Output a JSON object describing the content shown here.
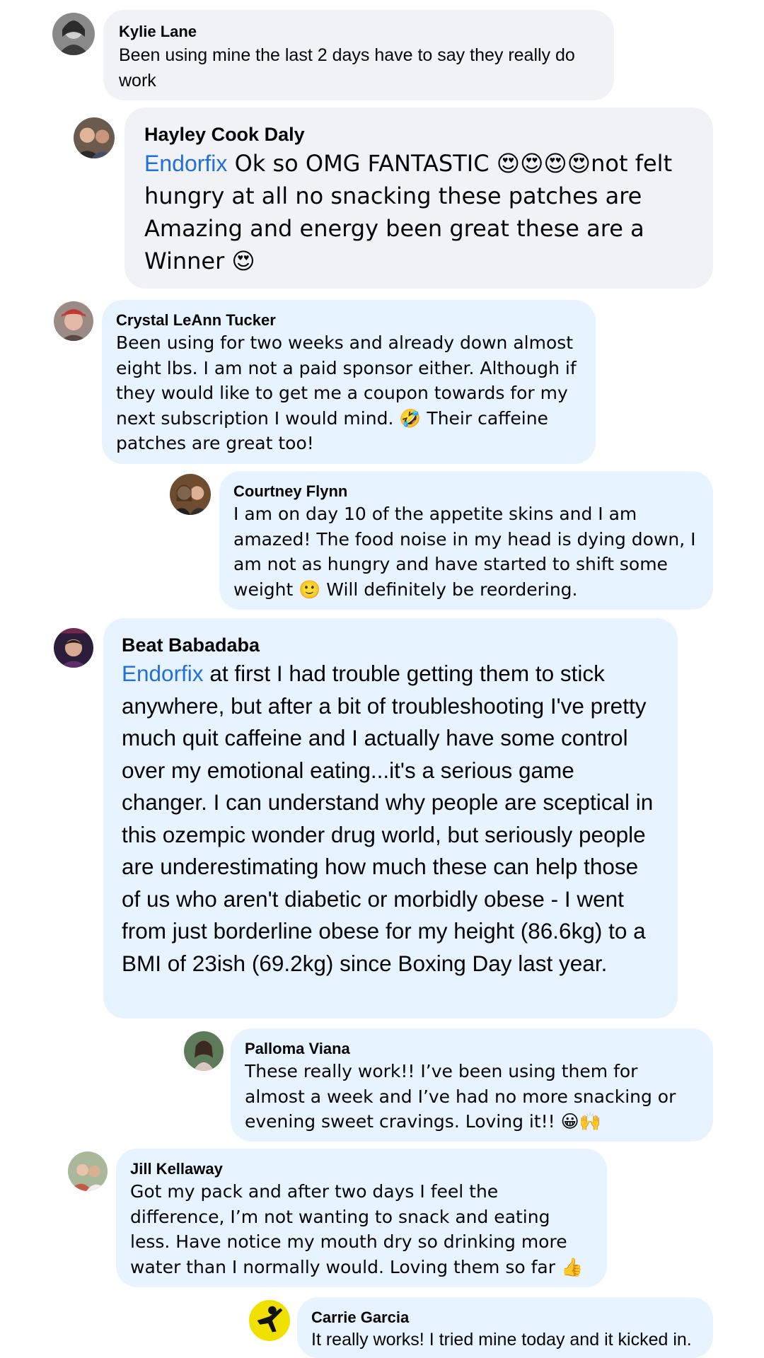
{
  "comments": [
    {
      "name": "Kylie Lane",
      "text": "Been using mine the last 2 days have to say they really do work"
    },
    {
      "name": "Hayley Cook Daly",
      "mention": "Endorfix",
      "text": " Ok so OMG FANTASTIC 😍😍😍😍not felt hungry at all no snacking these patches are Amazing and energy been great these are a Winner 😍"
    },
    {
      "name": "Crystal LeAnn Tucker",
      "text": "Been using for two weeks and already down almost eight lbs. I am not a paid sponsor either. Although if they would like to get me a coupon towards for my next subscription I would mind. 🤣 Their caffeine patches are great too!"
    },
    {
      "name": "Courtney Flynn",
      "text": "I am on day 10 of the appetite skins and I am amazed! The food noise in my head is dying down, I am not as hungry and have started to shift some weight 🙂 Will definitely be reordering."
    },
    {
      "name": "Beat Babadaba",
      "mention": "Endorfix",
      "text": " at first I had trouble getting them to stick anywhere, but after a bit of troubleshooting I've pretty much quit caffeine and I actually have some control over my emotional eating...it's a serious game changer. I can understand why people are sceptical in this ozempic wonder drug world, but seriously people are underestimating how much these can help those of us who aren't diabetic or morbidly obese - I went from just borderline obese for my height (86.6kg) to a BMI of 23ish (69.2kg) since Boxing Day last year."
    },
    {
      "name": "Palloma Viana",
      "text": "These really work!! I’ve been using them for almost a week and I’ve had no more snacking or evening sweet cravings. Loving it!! 😀🙌"
    },
    {
      "name": "Jill Kellaway",
      "text": "Got my pack and after two days I feel the difference, I’m not wanting to snack and eating less. Have notice my mouth dry so drinking more water than I normally would. Loving them so far 👍"
    },
    {
      "name": "Carrie Garcia",
      "text": "It really works! I tried mine today and it kicked in."
    }
  ]
}
